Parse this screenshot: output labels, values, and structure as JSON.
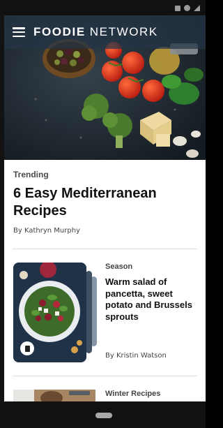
{
  "app": {
    "brand_bold": "FOODIE",
    "brand_light": "NETWORK"
  },
  "featured": {
    "kicker": "Trending",
    "title": "6 Easy Mediterranean Recipes",
    "byline": "By Kathryn Murphy"
  },
  "stories": [
    {
      "kicker": "Season",
      "title": "Warm salad of pancetta, sweet potato and Brussels sprouts",
      "byline": "By Kristin Watson"
    },
    {
      "kicker": "Winter Recipes",
      "title": "",
      "byline": ""
    }
  ],
  "icons": {
    "menu": "hamburger-menu-icon",
    "badge": "bookmark-icon"
  },
  "colors": {
    "header_overlay": "#243446",
    "text_primary": "#111111",
    "text_secondary": "#444444",
    "divider": "#dddddd"
  }
}
